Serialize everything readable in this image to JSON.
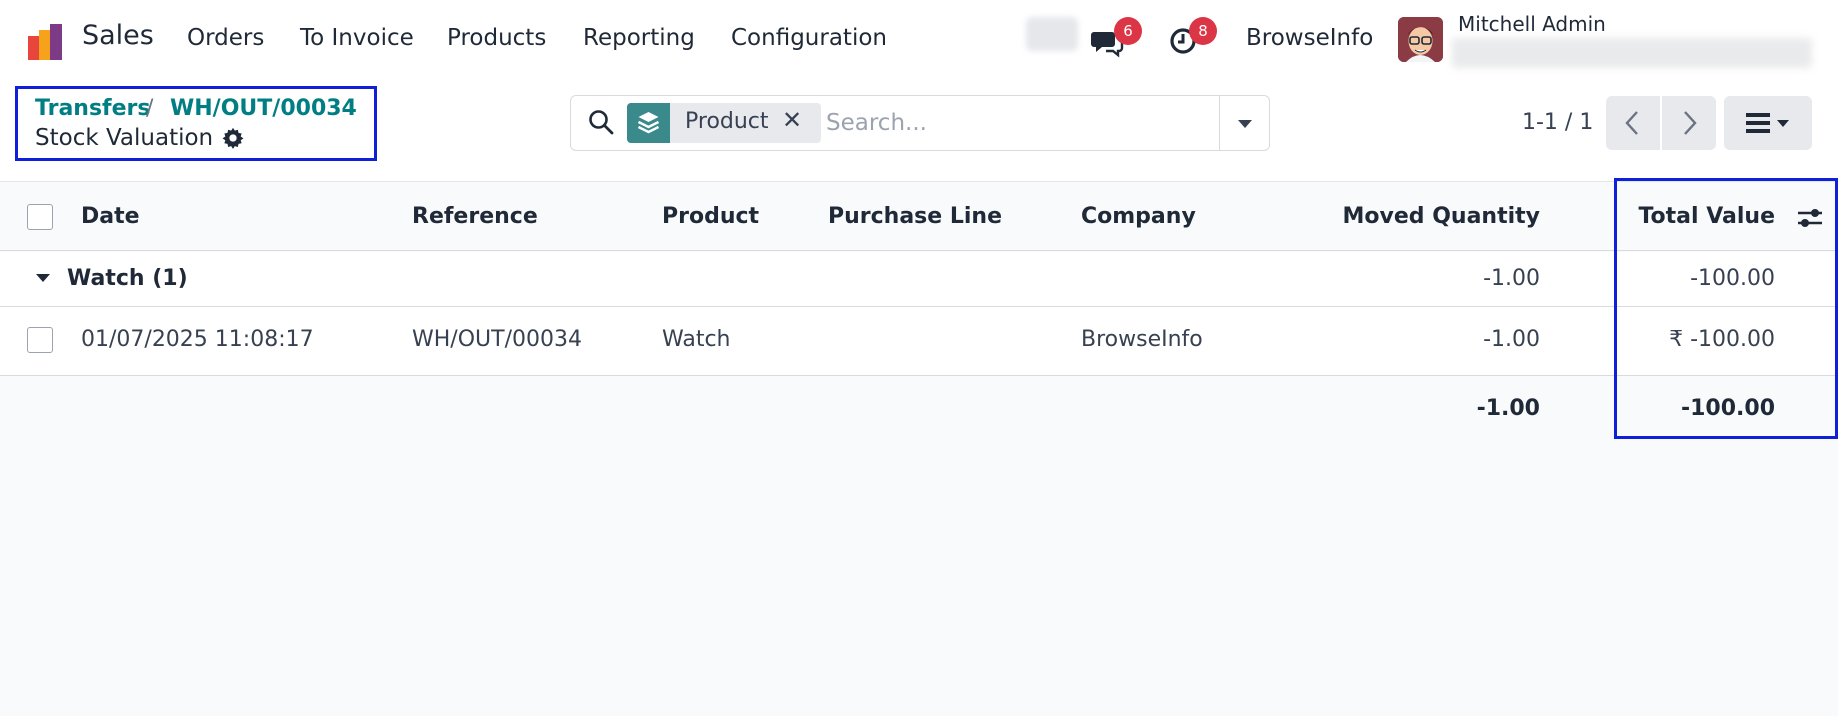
{
  "navbar": {
    "app_name": "Sales",
    "menu": [
      "Orders",
      "To Invoice",
      "Products",
      "Reporting",
      "Configuration"
    ],
    "messages_count": "6",
    "activities_count": "8",
    "company": "BrowseInfo",
    "user_name": "Mitchell Admin"
  },
  "breadcrumb": {
    "items": [
      "Transfers",
      "WH/OUT/00034"
    ],
    "separator": "/",
    "title": "Stock Valuation"
  },
  "search": {
    "facet_label": "Product",
    "placeholder": "Search..."
  },
  "pager": {
    "text": "1-1 / 1"
  },
  "table": {
    "columns": [
      "Date",
      "Reference",
      "Product",
      "Purchase Line",
      "Company",
      "Moved Quantity",
      "Total Value"
    ],
    "group": {
      "label": "Watch (1)",
      "moved_quantity": "-1.00",
      "total_value": "-100.00"
    },
    "rows": [
      {
        "date": "01/07/2025 11:08:17",
        "reference": "WH/OUT/00034",
        "product": "Watch",
        "purchase_line": "",
        "company": "BrowseInfo",
        "moved_quantity": "-1.00",
        "total_value": "₹ -100.00"
      }
    ],
    "footer": {
      "moved_quantity": "-1.00",
      "total_value": "-100.00"
    }
  },
  "colors": {
    "accent": "#017e84",
    "badge": "#dc3545",
    "highlight": "#1020d8"
  }
}
